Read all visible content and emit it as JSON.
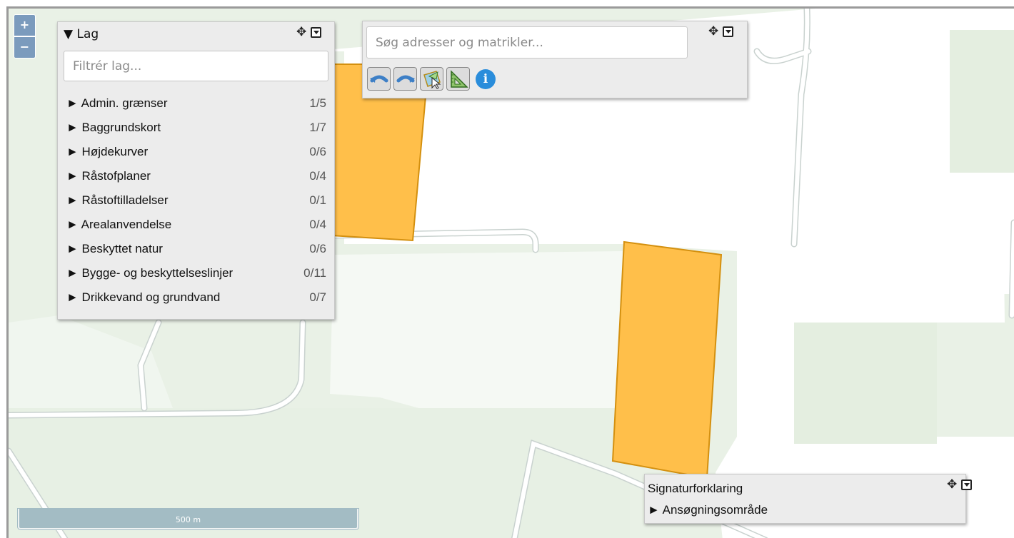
{
  "zoom": {
    "in_label": "+",
    "out_label": "−"
  },
  "layers_panel": {
    "title": "▼ Lag",
    "filter_placeholder": "Filtrér lag...",
    "items": [
      {
        "label": "► Admin. grænser",
        "count": "1/5"
      },
      {
        "label": "► Baggrundskort",
        "count": "1/7"
      },
      {
        "label": "► Højdekurver",
        "count": "0/6"
      },
      {
        "label": "► Råstofplaner",
        "count": "0/4"
      },
      {
        "label": "► Råstoftilladelser",
        "count": "0/1"
      },
      {
        "label": "► Arealanvendelse",
        "count": "0/4"
      },
      {
        "label": "► Beskyttet natur",
        "count": "0/6"
      },
      {
        "label": "► Bygge- og beskyttelseslinjer",
        "count": "0/11"
      },
      {
        "label": "► Drikkevand og grundvand",
        "count": "0/7"
      }
    ]
  },
  "search_panel": {
    "placeholder": "Søg adresser og matrikler...",
    "tools": [
      "undo-icon",
      "redo-icon",
      "select-polygon-icon",
      "measure-icon",
      "info-icon"
    ],
    "info_label": "i"
  },
  "legend_panel": {
    "title": "Signaturforklaring",
    "item": "► Ansøgningsområde"
  },
  "scale": {
    "label": "500 m"
  },
  "colors": {
    "parcel_fill": "#ffbf4a",
    "parcel_stroke": "#d4900f",
    "field_green": "#e9f1e6",
    "road": "#ffffff",
    "panel_bg": "#ececec",
    "zoom_bg": "#7b9bbd",
    "info_blue": "#2a8ddb"
  }
}
